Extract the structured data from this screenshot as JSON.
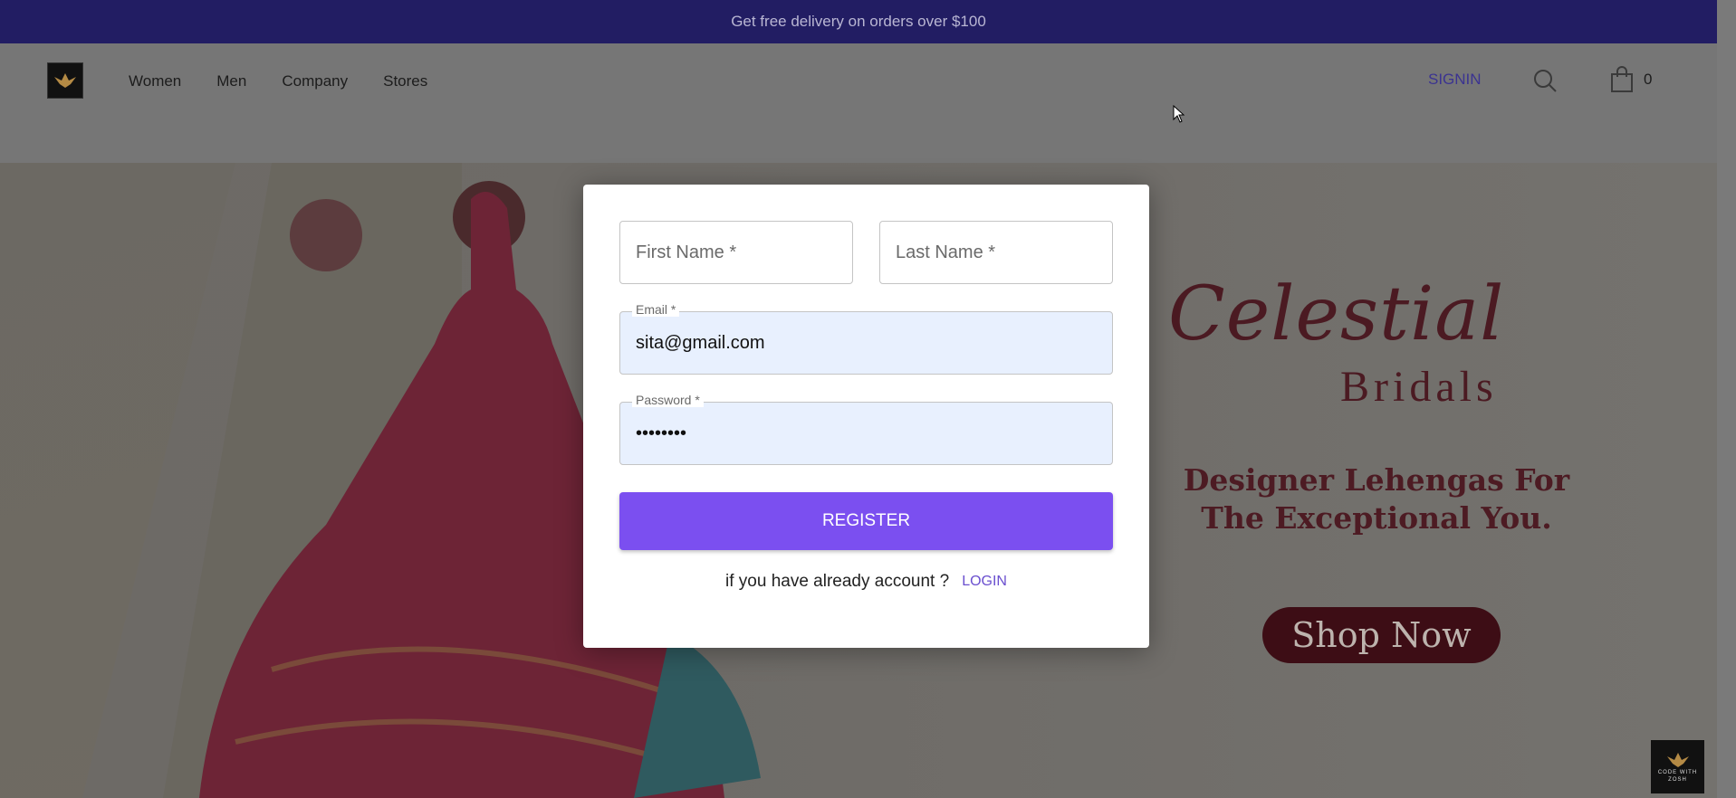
{
  "announcement": "Get free delivery on orders over $100",
  "nav": {
    "items": [
      "Women",
      "Men",
      "Company",
      "Stores"
    ]
  },
  "header": {
    "signin": "SIGNIN",
    "cart_count": "0",
    "search_icon": "search-icon",
    "cart_icon": "shopping-bag-icon"
  },
  "hero": {
    "brand_line1": "Celestial",
    "brand_line2": "Bridals",
    "tagline": "Designer Lehengas For The Exceptional You.",
    "cta": "Shop Now",
    "badge": "CODE WITH ZOSH"
  },
  "register_form": {
    "first_name_placeholder": "First Name *",
    "last_name_placeholder": "Last Name *",
    "email_label": "Email *",
    "email_value": "sita@gmail.com",
    "password_label": "Password *",
    "password_value": "••••••••",
    "submit": "REGISTER",
    "login_prompt": "if you have already account ?",
    "login_link": "LOGIN"
  },
  "colors": {
    "accent": "#7b4ff0",
    "topbar": "#221d63",
    "brand": "#4b1a22"
  }
}
